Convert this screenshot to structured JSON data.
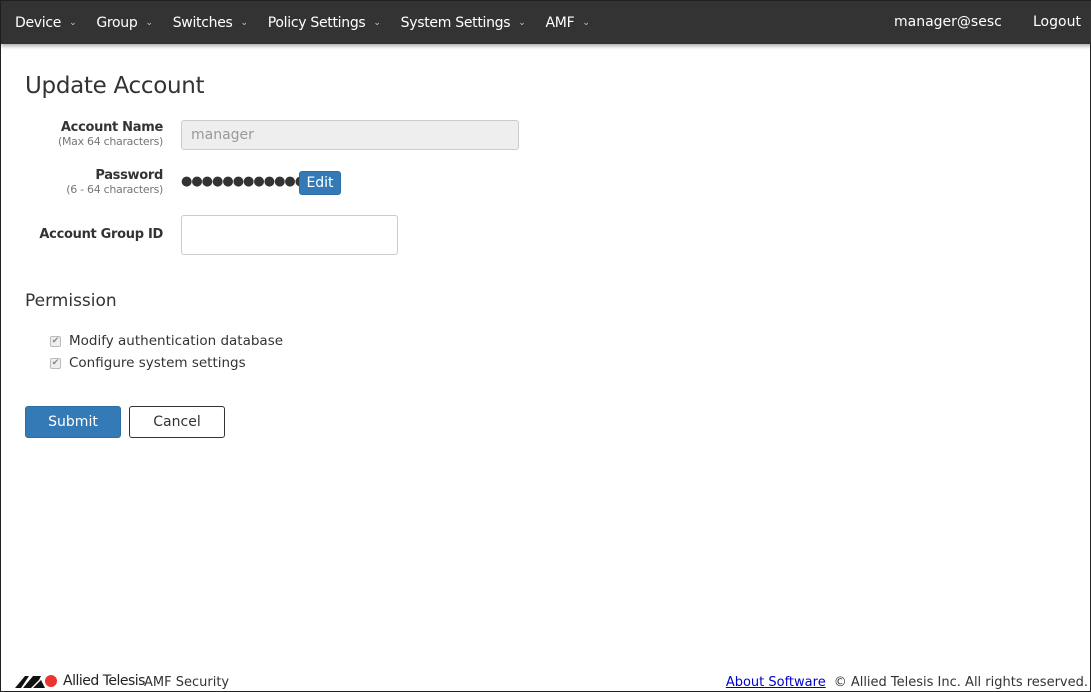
{
  "nav": {
    "items": [
      {
        "label": "Device"
      },
      {
        "label": "Group"
      },
      {
        "label": "Switches"
      },
      {
        "label": "Policy Settings"
      },
      {
        "label": "System Settings"
      },
      {
        "label": "AMF"
      }
    ],
    "user": "manager@sesc",
    "logout": "Logout"
  },
  "page": {
    "title": "Update Account"
  },
  "form": {
    "account_name": {
      "label": "Account Name",
      "hint": "(Max 64 characters)",
      "value": "manager"
    },
    "password": {
      "label": "Password",
      "hint": "(6 - 64 characters)",
      "masked": "●●●●●●●●●●●●●●",
      "edit": "Edit"
    },
    "group_id": {
      "label": "Account Group ID",
      "value": ""
    }
  },
  "permission": {
    "title": "Permission",
    "items": [
      {
        "label": "Modify authentication database",
        "checked": true
      },
      {
        "label": "Configure system settings",
        "checked": true
      }
    ]
  },
  "actions": {
    "submit": "Submit",
    "cancel": "Cancel"
  },
  "footer": {
    "brand": "Allied Telesis",
    "product": "AMF Security",
    "about": "About Software",
    "copyright": "© Allied Telesis Inc. All rights reserved."
  }
}
